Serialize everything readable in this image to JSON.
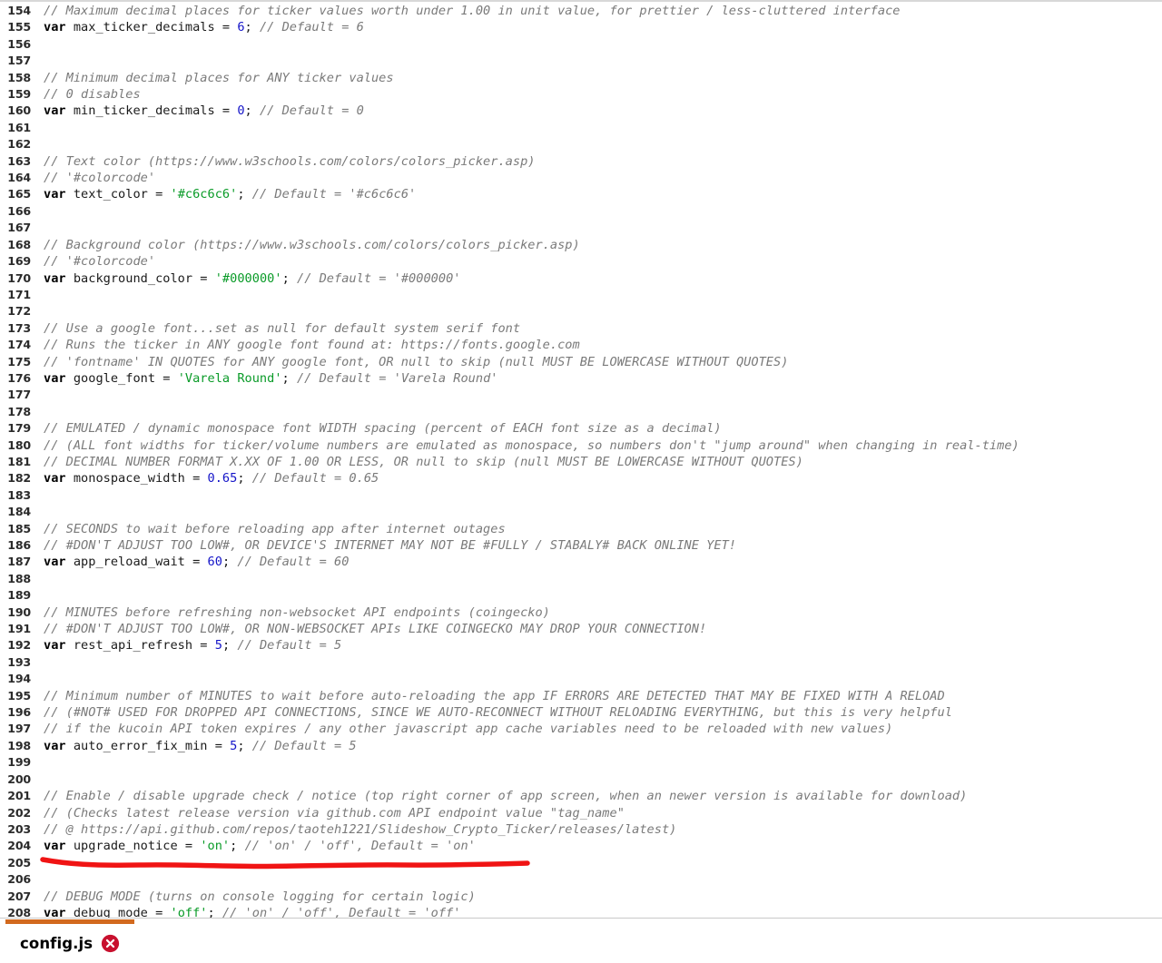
{
  "editor": {
    "first_line_number": 154,
    "colors": {
      "background": "#ffffff",
      "comment": "#7a7a7a",
      "keyword": "#000000",
      "string": "#0a9b28",
      "number": "#1414c8",
      "line_number": "#2b2b2b",
      "annotation_red": "#f01414",
      "tab_accent": "#d2691e",
      "close_icon": "#c8102e"
    },
    "lines": [
      {
        "n": 154,
        "tokens": [
          {
            "t": "com",
            "s": "// Maximum decimal places for ticker values worth under 1.00 in unit value, for prettier / less-cluttered interface"
          }
        ]
      },
      {
        "n": 155,
        "tokens": [
          {
            "t": "kw",
            "s": "var"
          },
          {
            "t": "plain",
            "s": " max_ticker_decimals = "
          },
          {
            "t": "num",
            "s": "6"
          },
          {
            "t": "plain",
            "s": "; "
          },
          {
            "t": "com",
            "s": "// Default = 6"
          }
        ]
      },
      {
        "n": 156,
        "tokens": []
      },
      {
        "n": 157,
        "tokens": []
      },
      {
        "n": 158,
        "tokens": [
          {
            "t": "com",
            "s": "// Minimum decimal places for ANY ticker values"
          }
        ]
      },
      {
        "n": 159,
        "tokens": [
          {
            "t": "com",
            "s": "// 0 disables"
          }
        ]
      },
      {
        "n": 160,
        "tokens": [
          {
            "t": "kw",
            "s": "var"
          },
          {
            "t": "plain",
            "s": " min_ticker_decimals = "
          },
          {
            "t": "num",
            "s": "0"
          },
          {
            "t": "plain",
            "s": "; "
          },
          {
            "t": "com",
            "s": "// Default = 0"
          }
        ]
      },
      {
        "n": 161,
        "tokens": []
      },
      {
        "n": 162,
        "tokens": []
      },
      {
        "n": 163,
        "tokens": [
          {
            "t": "com",
            "s": "// Text color (https://www.w3schools.com/colors/colors_picker.asp)"
          }
        ]
      },
      {
        "n": 164,
        "tokens": [
          {
            "t": "com",
            "s": "// '#colorcode'"
          }
        ]
      },
      {
        "n": 165,
        "tokens": [
          {
            "t": "kw",
            "s": "var"
          },
          {
            "t": "plain",
            "s": " text_color = "
          },
          {
            "t": "str",
            "s": "'#c6c6c6'"
          },
          {
            "t": "plain",
            "s": "; "
          },
          {
            "t": "com",
            "s": "// Default = '#c6c6c6'"
          }
        ]
      },
      {
        "n": 166,
        "tokens": []
      },
      {
        "n": 167,
        "tokens": []
      },
      {
        "n": 168,
        "tokens": [
          {
            "t": "com",
            "s": "// Background color (https://www.w3schools.com/colors/colors_picker.asp)"
          }
        ]
      },
      {
        "n": 169,
        "tokens": [
          {
            "t": "com",
            "s": "// '#colorcode'"
          }
        ]
      },
      {
        "n": 170,
        "tokens": [
          {
            "t": "kw",
            "s": "var"
          },
          {
            "t": "plain",
            "s": " background_color = "
          },
          {
            "t": "str",
            "s": "'#000000'"
          },
          {
            "t": "plain",
            "s": "; "
          },
          {
            "t": "com",
            "s": "// Default = '#000000'"
          }
        ]
      },
      {
        "n": 171,
        "tokens": []
      },
      {
        "n": 172,
        "tokens": []
      },
      {
        "n": 173,
        "tokens": [
          {
            "t": "com",
            "s": "// Use a google font...set as null for default system serif font"
          }
        ]
      },
      {
        "n": 174,
        "tokens": [
          {
            "t": "com",
            "s": "// Runs the ticker in ANY google font found at: https://fonts.google.com"
          }
        ]
      },
      {
        "n": 175,
        "tokens": [
          {
            "t": "com",
            "s": "// 'fontname' IN QUOTES for ANY google font, OR null to skip (null MUST BE LOWERCASE WITHOUT QUOTES)"
          }
        ]
      },
      {
        "n": 176,
        "tokens": [
          {
            "t": "kw",
            "s": "var"
          },
          {
            "t": "plain",
            "s": " google_font = "
          },
          {
            "t": "str",
            "s": "'Varela Round'"
          },
          {
            "t": "plain",
            "s": "; "
          },
          {
            "t": "com",
            "s": "// Default = 'Varela Round'"
          }
        ]
      },
      {
        "n": 177,
        "tokens": []
      },
      {
        "n": 178,
        "tokens": []
      },
      {
        "n": 179,
        "tokens": [
          {
            "t": "com",
            "s": "// EMULATED / dynamic monospace font WIDTH spacing (percent of EACH font size as a decimal)"
          }
        ]
      },
      {
        "n": 180,
        "tokens": [
          {
            "t": "com",
            "s": "// (ALL font widths for ticker/volume numbers are emulated as monospace, so numbers don't \"jump around\" when changing in real-time)"
          }
        ]
      },
      {
        "n": 181,
        "tokens": [
          {
            "t": "com",
            "s": "// DECIMAL NUMBER FORMAT X.XX OF 1.00 OR LESS, OR null to skip (null MUST BE LOWERCASE WITHOUT QUOTES)"
          }
        ]
      },
      {
        "n": 182,
        "tokens": [
          {
            "t": "kw",
            "s": "var"
          },
          {
            "t": "plain",
            "s": " monospace_width = "
          },
          {
            "t": "num",
            "s": "0.65"
          },
          {
            "t": "plain",
            "s": "; "
          },
          {
            "t": "com",
            "s": "// Default = 0.65"
          }
        ]
      },
      {
        "n": 183,
        "tokens": []
      },
      {
        "n": 184,
        "tokens": []
      },
      {
        "n": 185,
        "tokens": [
          {
            "t": "com",
            "s": "// SECONDS to wait before reloading app after internet outages"
          }
        ]
      },
      {
        "n": 186,
        "tokens": [
          {
            "t": "com",
            "s": "// #DON'T ADJUST TOO LOW#, OR DEVICE'S INTERNET MAY NOT BE #FULLY / STABALY# BACK ONLINE YET!"
          }
        ]
      },
      {
        "n": 187,
        "tokens": [
          {
            "t": "kw",
            "s": "var"
          },
          {
            "t": "plain",
            "s": " app_reload_wait = "
          },
          {
            "t": "num",
            "s": "60"
          },
          {
            "t": "plain",
            "s": "; "
          },
          {
            "t": "com",
            "s": "// Default = 60"
          }
        ]
      },
      {
        "n": 188,
        "tokens": []
      },
      {
        "n": 189,
        "tokens": []
      },
      {
        "n": 190,
        "tokens": [
          {
            "t": "com",
            "s": "// MINUTES before refreshing non-websocket API endpoints (coingecko)"
          }
        ]
      },
      {
        "n": 191,
        "tokens": [
          {
            "t": "com",
            "s": "// #DON'T ADJUST TOO LOW#, OR NON-WEBSOCKET APIs LIKE COINGECKO MAY DROP YOUR CONNECTION!"
          }
        ]
      },
      {
        "n": 192,
        "tokens": [
          {
            "t": "kw",
            "s": "var"
          },
          {
            "t": "plain",
            "s": " rest_api_refresh = "
          },
          {
            "t": "num",
            "s": "5"
          },
          {
            "t": "plain",
            "s": "; "
          },
          {
            "t": "com",
            "s": "// Default = 5"
          }
        ]
      },
      {
        "n": 193,
        "tokens": []
      },
      {
        "n": 194,
        "tokens": []
      },
      {
        "n": 195,
        "tokens": [
          {
            "t": "com",
            "s": "// Minimum number of MINUTES to wait before auto-reloading the app IF ERRORS ARE DETECTED THAT MAY BE FIXED WITH A RELOAD"
          }
        ]
      },
      {
        "n": 196,
        "tokens": [
          {
            "t": "com",
            "s": "// (#NOT# USED FOR DROPPED API CONNECTIONS, SINCE WE AUTO-RECONNECT WITHOUT RELOADING EVERYTHING, but this is very helpful"
          }
        ]
      },
      {
        "n": 197,
        "tokens": [
          {
            "t": "com",
            "s": "// if the kucoin API token expires / any other javascript app cache variables need to be reloaded with new values)"
          }
        ]
      },
      {
        "n": 198,
        "tokens": [
          {
            "t": "kw",
            "s": "var"
          },
          {
            "t": "plain",
            "s": " auto_error_fix_min = "
          },
          {
            "t": "num",
            "s": "5"
          },
          {
            "t": "plain",
            "s": "; "
          },
          {
            "t": "com",
            "s": "// Default = 5"
          }
        ]
      },
      {
        "n": 199,
        "tokens": []
      },
      {
        "n": 200,
        "tokens": []
      },
      {
        "n": 201,
        "tokens": [
          {
            "t": "com",
            "s": "// Enable / disable upgrade check / notice (top right corner of app screen, when an newer version is available for download)"
          }
        ]
      },
      {
        "n": 202,
        "tokens": [
          {
            "t": "com",
            "s": "// (Checks latest release version via github.com API endpoint value \"tag_name\""
          }
        ]
      },
      {
        "n": 203,
        "tokens": [
          {
            "t": "com",
            "s": "// @ https://api.github.com/repos/taoteh1221/Slideshow_Crypto_Ticker/releases/latest)"
          }
        ]
      },
      {
        "n": 204,
        "tokens": [
          {
            "t": "kw",
            "s": "var"
          },
          {
            "t": "plain",
            "s": " upgrade_notice = "
          },
          {
            "t": "str",
            "s": "'on'"
          },
          {
            "t": "plain",
            "s": "; "
          },
          {
            "t": "com",
            "s": "// 'on' / 'off', Default = 'on'"
          }
        ]
      },
      {
        "n": 205,
        "tokens": []
      },
      {
        "n": 206,
        "tokens": []
      },
      {
        "n": 207,
        "tokens": [
          {
            "t": "com",
            "s": "// DEBUG MODE (turns on console logging for certain logic)"
          }
        ]
      },
      {
        "n": 208,
        "tokens": [
          {
            "t": "kw",
            "s": "var"
          },
          {
            "t": "plain",
            "s": " debug_mode = "
          },
          {
            "t": "str",
            "s": "'off'"
          },
          {
            "t": "plain",
            "s": "; "
          },
          {
            "t": "com",
            "s": "// 'on' / 'off', Default = 'off'"
          }
        ]
      }
    ]
  },
  "annotation": {
    "type": "red-underline",
    "target_line": 204,
    "color": "#f01414"
  },
  "tabbar": {
    "active_tab": "config.js",
    "close_icon": "close-circle-icon"
  }
}
